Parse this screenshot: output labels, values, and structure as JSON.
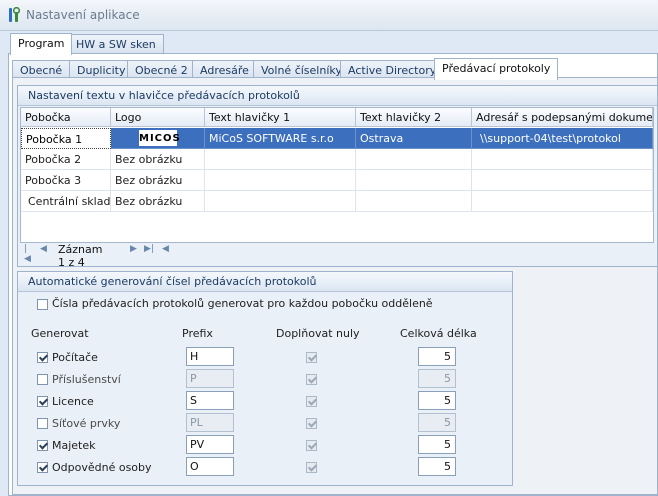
{
  "window": {
    "title": "Nastavení aplikace"
  },
  "outer_tabs": [
    {
      "label": "Program",
      "active": true
    },
    {
      "label": "HW a SW sken",
      "active": false
    }
  ],
  "inner_tabs": [
    {
      "label": "Obecné"
    },
    {
      "label": "Duplicity"
    },
    {
      "label": "Obecné 2"
    },
    {
      "label": "Adresáře"
    },
    {
      "label": "Volné číselníky"
    },
    {
      "label": "Active Directory"
    },
    {
      "label": "Předávací protokoly",
      "active": true
    }
  ],
  "header_group": {
    "title": "Nastavení textu v hlavičce předávacích protokolů",
    "columns": [
      "Pobočka",
      "Logo",
      "Text hlavičky 1",
      "Text hlavičky 2",
      "Adresář s podepsanými dokumenty"
    ],
    "rows": [
      {
        "branch": "Pobočka 1",
        "logo": "",
        "logo_image_text": "MICOS",
        "text1": "MiCoS SOFTWARE s.r.o",
        "text2": "Ostrava",
        "dir": "\\\\support-04\\test\\protokol",
        "selected": true
      },
      {
        "branch": "Pobočka 2",
        "logo": "Bez obrázku",
        "text1": "",
        "text2": "",
        "dir": ""
      },
      {
        "branch": "Pobočka 3",
        "logo": "Bez obrázku",
        "text1": "",
        "text2": "",
        "dir": ""
      },
      {
        "branch": "Centrální sklad",
        "logo": "Bez obrázku",
        "text1": "",
        "text2": "",
        "dir": ""
      }
    ],
    "navigator": {
      "record_text": "Záznam 1 z 4"
    }
  },
  "auto_group": {
    "title": "Automatické generování čísel předávacích protokolů",
    "per_branch": {
      "label": "Čísla předávacích protokolů generovat pro každou pobočku odděleně",
      "checked": false
    },
    "columns": {
      "generate": "Generovat",
      "prefix": "Prefix",
      "pad": "Doplňovat nuly",
      "length": "Celková délka"
    },
    "rows": [
      {
        "label": "Počítače",
        "enabled": true,
        "prefix": "H",
        "pad": true,
        "length": "5"
      },
      {
        "label": "Příslušenství",
        "enabled": false,
        "prefix": "P",
        "pad": true,
        "length": "5"
      },
      {
        "label": "Licence",
        "enabled": true,
        "prefix": "S",
        "pad": true,
        "length": "5"
      },
      {
        "label": "Síťové prvky",
        "enabled": false,
        "prefix": "PL",
        "pad": true,
        "length": "5"
      },
      {
        "label": "Majetek",
        "enabled": true,
        "prefix": "PV",
        "pad": true,
        "length": "5"
      },
      {
        "label": "Odpovědné osoby",
        "enabled": true,
        "prefix": "O",
        "pad": true,
        "length": "5"
      }
    ]
  },
  "icons": {
    "app": "tools-icon",
    "nav_first": "first-record-icon",
    "nav_prev": "prev-record-icon",
    "nav_next": "next-record-icon",
    "nav_last": "last-record-icon"
  },
  "colors": {
    "accent": "#3c6fbd",
    "panel": "#eaf0f7",
    "border": "#9fb3cc"
  }
}
